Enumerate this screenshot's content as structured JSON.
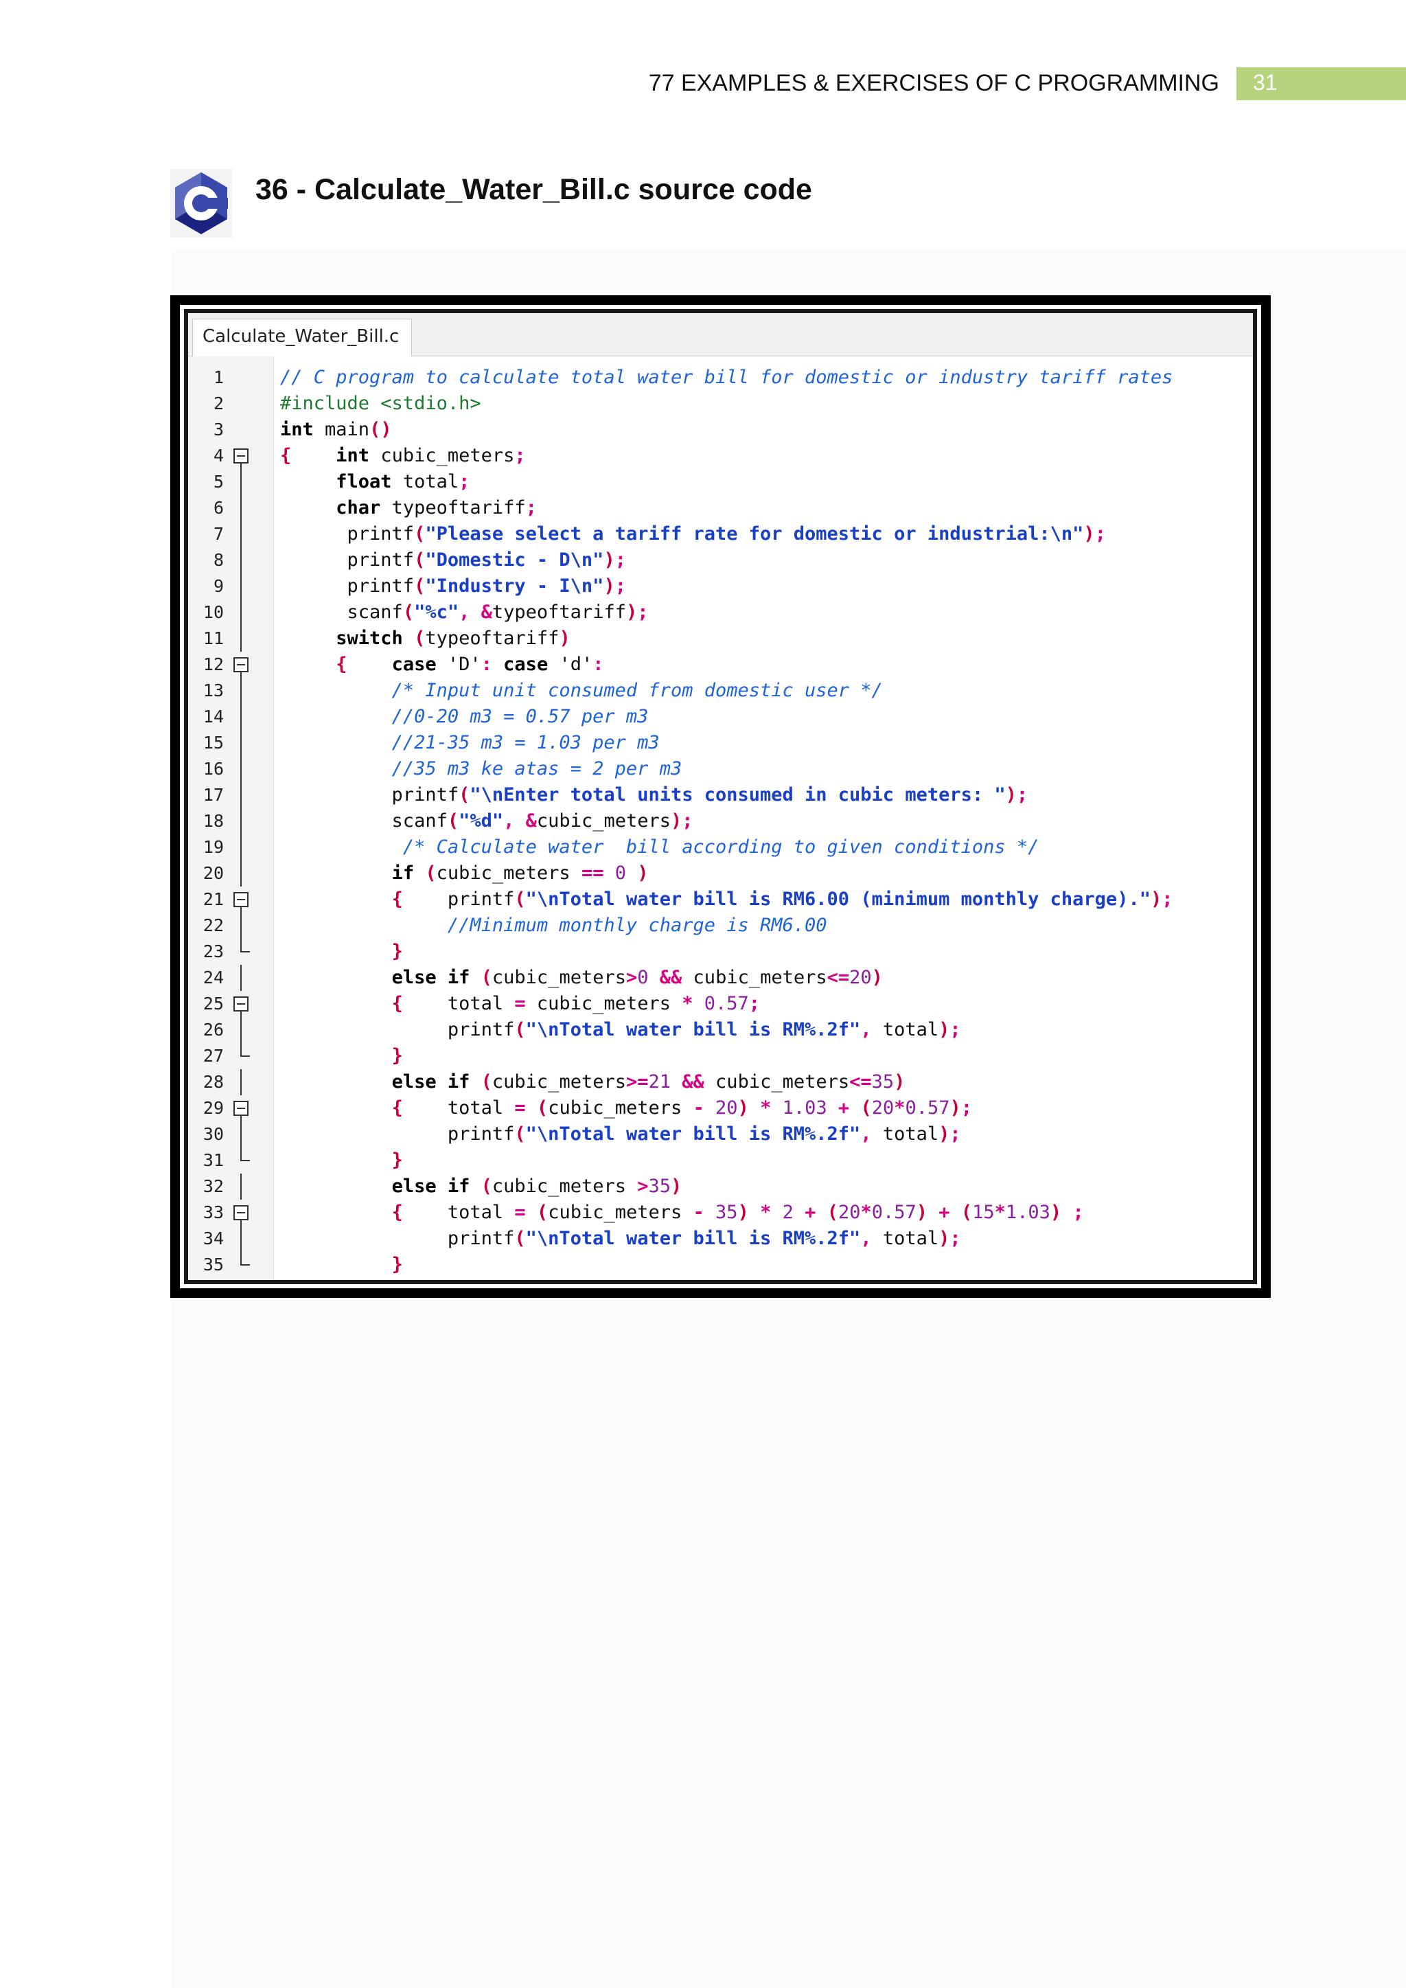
{
  "header": {
    "book_title": "77 EXAMPLES & EXERCISES OF C PROGRAMMING",
    "page_number": "31"
  },
  "section": {
    "title": "36 - Calculate_Water_Bill.c source code",
    "logo_letter": "C"
  },
  "editor": {
    "tab_label": "Calculate_Water_Bill.c",
    "lines": [
      [
        {
          "t": "// C program to calculate total water bill for domestic or industry tariff rates",
          "c": "cm"
        }
      ],
      [
        {
          "t": "#include <stdio.h>",
          "c": "pp"
        }
      ],
      [
        {
          "t": "int",
          "c": "kw"
        },
        {
          "t": " main",
          "c": "plain"
        },
        {
          "t": "()",
          "c": "br"
        }
      ],
      [
        {
          "t": "{",
          "c": "br"
        },
        {
          "t": "    ",
          "c": "plain"
        },
        {
          "t": "int",
          "c": "kw"
        },
        {
          "t": " cubic_meters",
          "c": "plain"
        },
        {
          "t": ";",
          "c": "op"
        }
      ],
      [
        {
          "t": "     ",
          "c": "plain"
        },
        {
          "t": "float",
          "c": "kw"
        },
        {
          "t": " total",
          "c": "plain"
        },
        {
          "t": ";",
          "c": "op"
        }
      ],
      [
        {
          "t": "     ",
          "c": "plain"
        },
        {
          "t": "char",
          "c": "kw"
        },
        {
          "t": " typeoftariff",
          "c": "plain"
        },
        {
          "t": ";",
          "c": "op"
        }
      ],
      [
        {
          "t": "      printf",
          "c": "plain"
        },
        {
          "t": "(",
          "c": "br"
        },
        {
          "t": "\"Please select a tariff rate for domestic or industrial:\\n\"",
          "c": "st"
        },
        {
          "t": ")",
          "c": "br"
        },
        {
          "t": ";",
          "c": "op"
        }
      ],
      [
        {
          "t": "      printf",
          "c": "plain"
        },
        {
          "t": "(",
          "c": "br"
        },
        {
          "t": "\"Domestic - D\\n\"",
          "c": "st"
        },
        {
          "t": ")",
          "c": "br"
        },
        {
          "t": ";",
          "c": "op"
        }
      ],
      [
        {
          "t": "      printf",
          "c": "plain"
        },
        {
          "t": "(",
          "c": "br"
        },
        {
          "t": "\"Industry - I\\n\"",
          "c": "st"
        },
        {
          "t": ")",
          "c": "br"
        },
        {
          "t": ";",
          "c": "op"
        }
      ],
      [
        {
          "t": "      scanf",
          "c": "plain"
        },
        {
          "t": "(",
          "c": "br"
        },
        {
          "t": "\"%c\"",
          "c": "st"
        },
        {
          "t": ", ",
          "c": "op"
        },
        {
          "t": "&",
          "c": "op"
        },
        {
          "t": "typeoftariff",
          "c": "plain"
        },
        {
          "t": ")",
          "c": "br"
        },
        {
          "t": ";",
          "c": "op"
        }
      ],
      [
        {
          "t": "     ",
          "c": "plain"
        },
        {
          "t": "switch",
          "c": "kw"
        },
        {
          "t": " ",
          "c": "plain"
        },
        {
          "t": "(",
          "c": "br"
        },
        {
          "t": "typeoftariff",
          "c": "plain"
        },
        {
          "t": ")",
          "c": "br"
        }
      ],
      [
        {
          "t": "     ",
          "c": "plain"
        },
        {
          "t": "{",
          "c": "br"
        },
        {
          "t": "    ",
          "c": "plain"
        },
        {
          "t": "case",
          "c": "kw"
        },
        {
          "t": " 'D'",
          "c": "plain"
        },
        {
          "t": ":",
          "c": "op"
        },
        {
          "t": " ",
          "c": "plain"
        },
        {
          "t": "case",
          "c": "kw"
        },
        {
          "t": " 'd'",
          "c": "plain"
        },
        {
          "t": ":",
          "c": "op"
        }
      ],
      [
        {
          "t": "          ",
          "c": "plain"
        },
        {
          "t": "/* Input unit consumed from domestic user */",
          "c": "cm"
        }
      ],
      [
        {
          "t": "          ",
          "c": "plain"
        },
        {
          "t": "//0-20 m3 = 0.57 per m3",
          "c": "cm"
        }
      ],
      [
        {
          "t": "          ",
          "c": "plain"
        },
        {
          "t": "//21-35 m3 = 1.03 per m3",
          "c": "cm"
        }
      ],
      [
        {
          "t": "          ",
          "c": "plain"
        },
        {
          "t": "//35 m3 ke atas = 2 per m3",
          "c": "cm"
        }
      ],
      [
        {
          "t": "          printf",
          "c": "plain"
        },
        {
          "t": "(",
          "c": "br"
        },
        {
          "t": "\"\\nEnter total units consumed in cubic meters: \"",
          "c": "st"
        },
        {
          "t": ")",
          "c": "br"
        },
        {
          "t": ";",
          "c": "op"
        }
      ],
      [
        {
          "t": "          scanf",
          "c": "plain"
        },
        {
          "t": "(",
          "c": "br"
        },
        {
          "t": "\"%d\"",
          "c": "st"
        },
        {
          "t": ", ",
          "c": "op"
        },
        {
          "t": "&",
          "c": "op"
        },
        {
          "t": "cubic_meters",
          "c": "plain"
        },
        {
          "t": ")",
          "c": "br"
        },
        {
          "t": ";",
          "c": "op"
        }
      ],
      [
        {
          "t": "           ",
          "c": "plain"
        },
        {
          "t": "/* Calculate water  bill according to given conditions */",
          "c": "cm"
        }
      ],
      [
        {
          "t": "          ",
          "c": "plain"
        },
        {
          "t": "if",
          "c": "kw"
        },
        {
          "t": " ",
          "c": "plain"
        },
        {
          "t": "(",
          "c": "br"
        },
        {
          "t": "cubic_meters ",
          "c": "plain"
        },
        {
          "t": "==",
          "c": "op"
        },
        {
          "t": " ",
          "c": "plain"
        },
        {
          "t": "0",
          "c": "nm"
        },
        {
          "t": " ",
          "c": "plain"
        },
        {
          "t": ")",
          "c": "br"
        }
      ],
      [
        {
          "t": "          ",
          "c": "plain"
        },
        {
          "t": "{",
          "c": "br"
        },
        {
          "t": "    printf",
          "c": "plain"
        },
        {
          "t": "(",
          "c": "br"
        },
        {
          "t": "\"\\nTotal water bill is RM6.00 (minimum monthly charge).\"",
          "c": "st"
        },
        {
          "t": ")",
          "c": "br"
        },
        {
          "t": ";",
          "c": "op"
        }
      ],
      [
        {
          "t": "               ",
          "c": "plain"
        },
        {
          "t": "//Minimum monthly charge is RM6.00",
          "c": "cm"
        }
      ],
      [
        {
          "t": "          ",
          "c": "plain"
        },
        {
          "t": "}",
          "c": "br"
        }
      ],
      [
        {
          "t": "          ",
          "c": "plain"
        },
        {
          "t": "else",
          "c": "kw"
        },
        {
          "t": " ",
          "c": "plain"
        },
        {
          "t": "if",
          "c": "kw"
        },
        {
          "t": " ",
          "c": "plain"
        },
        {
          "t": "(",
          "c": "br"
        },
        {
          "t": "cubic_meters",
          "c": "plain"
        },
        {
          "t": ">",
          "c": "op"
        },
        {
          "t": "0",
          "c": "nm"
        },
        {
          "t": " ",
          "c": "plain"
        },
        {
          "t": "&&",
          "c": "op"
        },
        {
          "t": " cubic_meters",
          "c": "plain"
        },
        {
          "t": "<=",
          "c": "op"
        },
        {
          "t": "20",
          "c": "nm"
        },
        {
          "t": ")",
          "c": "br"
        }
      ],
      [
        {
          "t": "          ",
          "c": "plain"
        },
        {
          "t": "{",
          "c": "br"
        },
        {
          "t": "    total ",
          "c": "plain"
        },
        {
          "t": "=",
          "c": "op"
        },
        {
          "t": " cubic_meters ",
          "c": "plain"
        },
        {
          "t": "*",
          "c": "op"
        },
        {
          "t": " ",
          "c": "plain"
        },
        {
          "t": "0.57",
          "c": "nm"
        },
        {
          "t": ";",
          "c": "op"
        }
      ],
      [
        {
          "t": "               printf",
          "c": "plain"
        },
        {
          "t": "(",
          "c": "br"
        },
        {
          "t": "\"\\nTotal water bill is RM%.2f\"",
          "c": "st"
        },
        {
          "t": ", ",
          "c": "op"
        },
        {
          "t": "total",
          "c": "plain"
        },
        {
          "t": ")",
          "c": "br"
        },
        {
          "t": ";",
          "c": "op"
        }
      ],
      [
        {
          "t": "          ",
          "c": "plain"
        },
        {
          "t": "}",
          "c": "br"
        }
      ],
      [
        {
          "t": "          ",
          "c": "plain"
        },
        {
          "t": "else",
          "c": "kw"
        },
        {
          "t": " ",
          "c": "plain"
        },
        {
          "t": "if",
          "c": "kw"
        },
        {
          "t": " ",
          "c": "plain"
        },
        {
          "t": "(",
          "c": "br"
        },
        {
          "t": "cubic_meters",
          "c": "plain"
        },
        {
          "t": ">=",
          "c": "op"
        },
        {
          "t": "21",
          "c": "nm"
        },
        {
          "t": " ",
          "c": "plain"
        },
        {
          "t": "&&",
          "c": "op"
        },
        {
          "t": " cubic_meters",
          "c": "plain"
        },
        {
          "t": "<=",
          "c": "op"
        },
        {
          "t": "35",
          "c": "nm"
        },
        {
          "t": ")",
          "c": "br"
        }
      ],
      [
        {
          "t": "          ",
          "c": "plain"
        },
        {
          "t": "{",
          "c": "br"
        },
        {
          "t": "    total ",
          "c": "plain"
        },
        {
          "t": "=",
          "c": "op"
        },
        {
          "t": " ",
          "c": "plain"
        },
        {
          "t": "(",
          "c": "br"
        },
        {
          "t": "cubic_meters ",
          "c": "plain"
        },
        {
          "t": "-",
          "c": "op"
        },
        {
          "t": " ",
          "c": "plain"
        },
        {
          "t": "20",
          "c": "nm"
        },
        {
          "t": ")",
          "c": "br"
        },
        {
          "t": " ",
          "c": "plain"
        },
        {
          "t": "*",
          "c": "op"
        },
        {
          "t": " ",
          "c": "plain"
        },
        {
          "t": "1.03",
          "c": "nm"
        },
        {
          "t": " ",
          "c": "plain"
        },
        {
          "t": "+",
          "c": "op"
        },
        {
          "t": " ",
          "c": "plain"
        },
        {
          "t": "(",
          "c": "br"
        },
        {
          "t": "20",
          "c": "nm"
        },
        {
          "t": "*",
          "c": "op"
        },
        {
          "t": "0.57",
          "c": "nm"
        },
        {
          "t": ")",
          "c": "br"
        },
        {
          "t": ";",
          "c": "op"
        }
      ],
      [
        {
          "t": "               printf",
          "c": "plain"
        },
        {
          "t": "(",
          "c": "br"
        },
        {
          "t": "\"\\nTotal water bill is RM%.2f\"",
          "c": "st"
        },
        {
          "t": ", ",
          "c": "op"
        },
        {
          "t": "total",
          "c": "plain"
        },
        {
          "t": ")",
          "c": "br"
        },
        {
          "t": ";",
          "c": "op"
        }
      ],
      [
        {
          "t": "          ",
          "c": "plain"
        },
        {
          "t": "}",
          "c": "br"
        }
      ],
      [
        {
          "t": "          ",
          "c": "plain"
        },
        {
          "t": "else",
          "c": "kw"
        },
        {
          "t": " ",
          "c": "plain"
        },
        {
          "t": "if",
          "c": "kw"
        },
        {
          "t": " ",
          "c": "plain"
        },
        {
          "t": "(",
          "c": "br"
        },
        {
          "t": "cubic_meters ",
          "c": "plain"
        },
        {
          "t": ">",
          "c": "op"
        },
        {
          "t": "35",
          "c": "nm"
        },
        {
          "t": ")",
          "c": "br"
        }
      ],
      [
        {
          "t": "          ",
          "c": "plain"
        },
        {
          "t": "{",
          "c": "br"
        },
        {
          "t": "    total ",
          "c": "plain"
        },
        {
          "t": "=",
          "c": "op"
        },
        {
          "t": " ",
          "c": "plain"
        },
        {
          "t": "(",
          "c": "br"
        },
        {
          "t": "cubic_meters ",
          "c": "plain"
        },
        {
          "t": "-",
          "c": "op"
        },
        {
          "t": " ",
          "c": "plain"
        },
        {
          "t": "35",
          "c": "nm"
        },
        {
          "t": ")",
          "c": "br"
        },
        {
          "t": " ",
          "c": "plain"
        },
        {
          "t": "*",
          "c": "op"
        },
        {
          "t": " ",
          "c": "plain"
        },
        {
          "t": "2",
          "c": "nm"
        },
        {
          "t": " ",
          "c": "plain"
        },
        {
          "t": "+",
          "c": "op"
        },
        {
          "t": " ",
          "c": "plain"
        },
        {
          "t": "(",
          "c": "br"
        },
        {
          "t": "20",
          "c": "nm"
        },
        {
          "t": "*",
          "c": "op"
        },
        {
          "t": "0.57",
          "c": "nm"
        },
        {
          "t": ")",
          "c": "br"
        },
        {
          "t": " ",
          "c": "plain"
        },
        {
          "t": "+",
          "c": "op"
        },
        {
          "t": " ",
          "c": "plain"
        },
        {
          "t": "(",
          "c": "br"
        },
        {
          "t": "15",
          "c": "nm"
        },
        {
          "t": "*",
          "c": "op"
        },
        {
          "t": "1.03",
          "c": "nm"
        },
        {
          "t": ")",
          "c": "br"
        },
        {
          "t": " ",
          "c": "plain"
        },
        {
          "t": ";",
          "c": "op"
        }
      ],
      [
        {
          "t": "               printf",
          "c": "plain"
        },
        {
          "t": "(",
          "c": "br"
        },
        {
          "t": "\"\\nTotal water bill is RM%.2f\"",
          "c": "st"
        },
        {
          "t": ", ",
          "c": "op"
        },
        {
          "t": "total",
          "c": "plain"
        },
        {
          "t": ")",
          "c": "br"
        },
        {
          "t": ";",
          "c": "op"
        }
      ],
      [
        {
          "t": "          ",
          "c": "plain"
        },
        {
          "t": "}",
          "c": "br"
        }
      ]
    ],
    "folds": [
      "",
      "",
      "",
      "open",
      "line",
      "line",
      "line",
      "line",
      "line",
      "line",
      "line",
      "open",
      "line",
      "line",
      "line",
      "line",
      "line",
      "line",
      "line",
      "line",
      "open",
      "line",
      "end",
      "line",
      "open",
      "line",
      "end",
      "line",
      "open",
      "line",
      "end",
      "line",
      "open",
      "line",
      "end"
    ]
  },
  "colors": {
    "accent_green": "#b6d37e",
    "logo_blue": "#283593",
    "logo_light": "#5c6bc0",
    "comment_blue": "#1f63d9",
    "string_blue": "#1a3fc7",
    "preprocessor_green": "#1d7a2c"
  },
  "icons": {
    "logo": "c-language-logo-icon"
  }
}
